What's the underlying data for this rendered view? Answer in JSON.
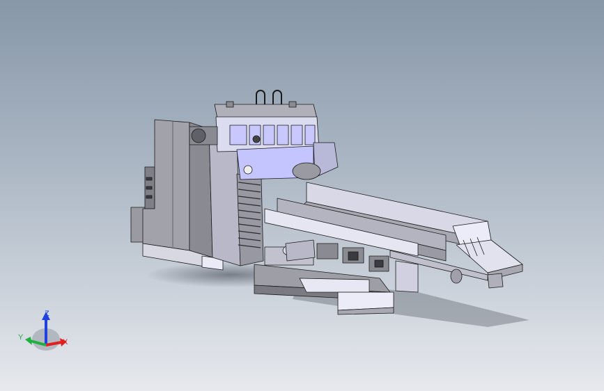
{
  "view": {
    "background_top": "#8797a8",
    "background_bottom": "#e7e9ee"
  },
  "model": {
    "body_color": "#a5a5ad",
    "highlight_color": "#ebebf7",
    "accent_color": "#c8c8ff",
    "edge_color": "#1a1a1a"
  },
  "triad": {
    "x_label": "X",
    "y_label": "Y",
    "z_label": "Z",
    "x_color": "#e02020",
    "y_color": "#20b040",
    "z_color": "#2040e0"
  }
}
